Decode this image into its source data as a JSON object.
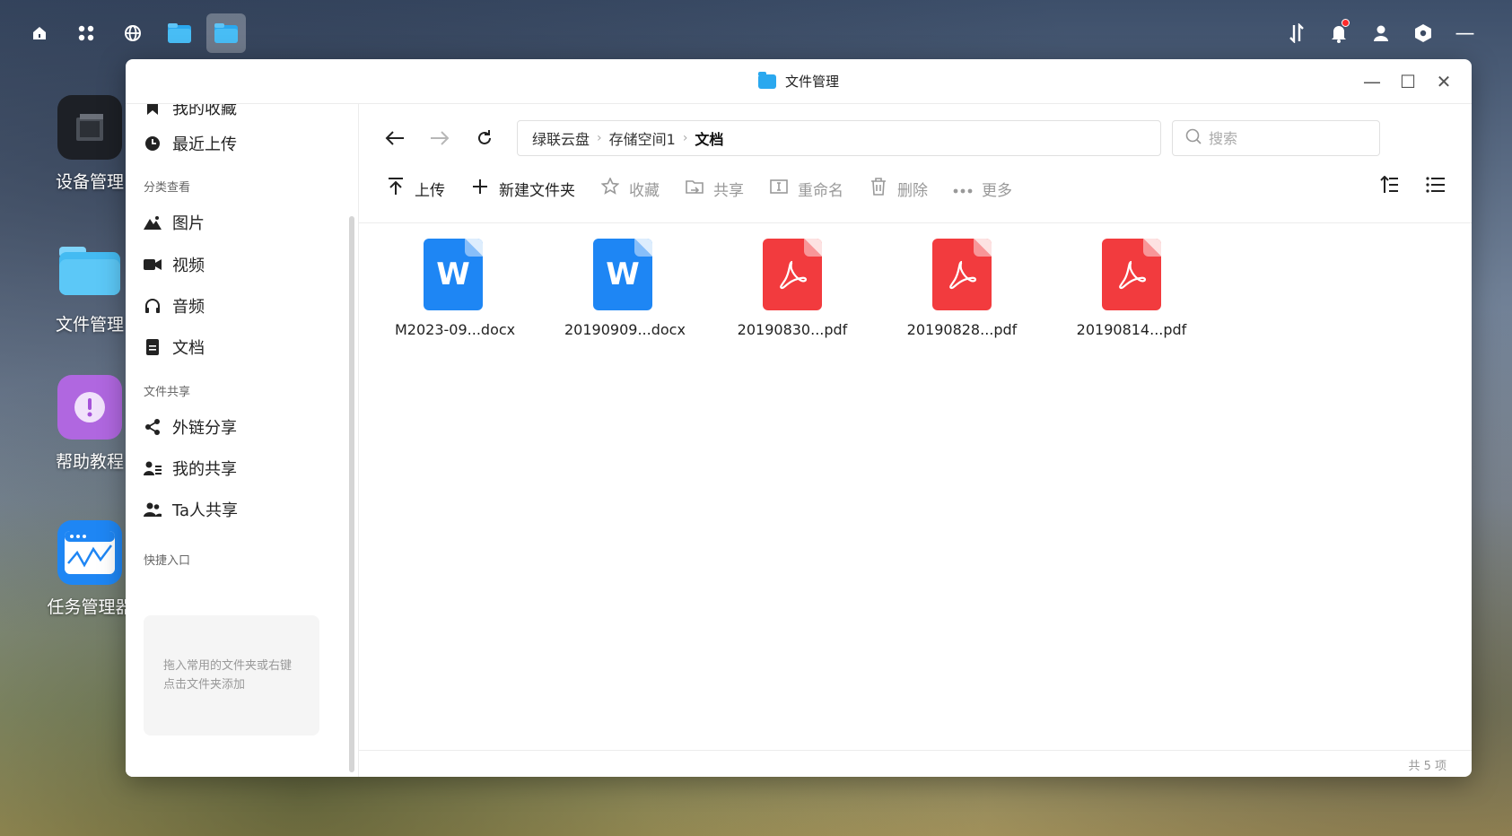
{
  "taskbar": {
    "left_buttons": [
      "home-icon",
      "apps-grid-icon",
      "globe-icon",
      "file-manager-icon",
      "file-manager-active-icon"
    ],
    "right_buttons": [
      "transfer-icon",
      "bell-icon",
      "user-icon",
      "settings-hex-icon"
    ],
    "minimize_symbol": "—"
  },
  "desktop_icons": [
    {
      "label": "设备管理"
    },
    {
      "label": "文件管理"
    },
    {
      "label": "帮助教程"
    },
    {
      "label": "任务管理器"
    }
  ],
  "window": {
    "title": "文件管理",
    "controls": {
      "minimize": "—",
      "maximize": "☐",
      "close": "✕"
    }
  },
  "sidebar": {
    "top_partial": "我的收藏",
    "recent_upload": "最近上传",
    "section_category": "分类查看",
    "categories": [
      {
        "label": "图片"
      },
      {
        "label": "视频"
      },
      {
        "label": "音频"
      },
      {
        "label": "文档"
      }
    ],
    "section_share": "文件共享",
    "shares": [
      {
        "label": "外链分享"
      },
      {
        "label": "我的共享"
      },
      {
        "label": "Ta人共享"
      }
    ],
    "section_quick": "快捷入口",
    "quick_hint": "拖入常用的文件夹或右键点击文件夹添加"
  },
  "nav": {
    "breadcrumb": [
      "绿联云盘",
      "存储空间1",
      "文档"
    ],
    "search_placeholder": "搜索"
  },
  "toolbar": {
    "upload": "上传",
    "new_folder": "新建文件夹",
    "favorite": "收藏",
    "share": "共享",
    "rename": "重命名",
    "delete": "删除",
    "more": "更多"
  },
  "files": [
    {
      "name": "M2023-09...docx",
      "type": "docx",
      "glyph": "W"
    },
    {
      "name": "20190909...docx",
      "type": "docx",
      "glyph": "W"
    },
    {
      "name": "20190830...pdf",
      "type": "pdf",
      "glyph": "pdf"
    },
    {
      "name": "20190828...pdf",
      "type": "pdf",
      "glyph": "pdf"
    },
    {
      "name": "20190814...pdf",
      "type": "pdf",
      "glyph": "pdf"
    }
  ],
  "status": {
    "count_text": "共 5 项"
  },
  "colors": {
    "docx": "#1e86f4",
    "pdf": "#f23b3e",
    "folder_blue": "#2aa8ef"
  }
}
